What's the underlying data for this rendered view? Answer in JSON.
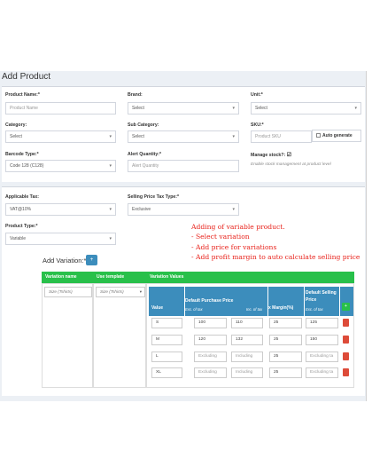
{
  "page": {
    "title": "Add Product"
  },
  "form": {
    "product_name": {
      "label": "Product Name:*",
      "placeholder": "Product Name"
    },
    "brand": {
      "label": "Brand:",
      "value": "Select"
    },
    "unit": {
      "label": "Unit:*",
      "value": "Select"
    },
    "category": {
      "label": "Category:",
      "value": "Select"
    },
    "sub_category": {
      "label": "Sub Category:",
      "value": "Select"
    },
    "sku": {
      "label": "SKU:*",
      "placeholder": "Product SKU",
      "auto_generate": "Auto generate"
    },
    "barcode_type": {
      "label": "Barcode Type:*",
      "value": "Code 128 (C128)"
    },
    "alert_quantity": {
      "label": "Alert Quantity:*",
      "placeholder": "Alert Quantity"
    },
    "manage_stock": {
      "label": "Manage stock?:",
      "checked": true,
      "help": "Enable stock management at product level"
    },
    "applicable_tax": {
      "label": "Applicable Tax:",
      "value": "VAT@10%"
    },
    "selling_price_tax_type": {
      "label": "Selling Price Tax Type:*",
      "value": "Exclusive"
    },
    "product_type": {
      "label": "Product Type:*",
      "value": "Variable"
    }
  },
  "annotation": "Adding of variable product.\n- Select variation\n- Add price for variations\n- Add profit margin to auto calculate selling price",
  "variations": {
    "add_label": "Add Variation:*",
    "add_button": "+",
    "headers": {
      "name": "Variation name",
      "template": "Use template",
      "values": "Variation Values"
    },
    "name_placeholder": "Size (Tshirts)",
    "template_value": "Size (Tshirts)",
    "table": {
      "value": "Value",
      "purchase": "Default Purchase Price",
      "exc_tax": "Exc. of tax",
      "inc_tax": "Inc. of tax",
      "margin": "x Margin(%)",
      "selling": "Default Selling Price",
      "selling_exc": "Exc. of tax",
      "add_row": "+"
    },
    "rows": [
      {
        "value": "S",
        "exc": "100",
        "inc": "110",
        "margin": "25",
        "sell": "125",
        "sell_ph": false
      },
      {
        "value": "M",
        "exc": "120",
        "inc": "132",
        "margin": "25",
        "sell": "150",
        "sell_ph": false
      },
      {
        "value": "L",
        "exc": "Excluding",
        "inc": "Including",
        "margin": "25",
        "sell": "Excluding ta",
        "sell_ph": true
      },
      {
        "value": "XL",
        "exc": "Excluding",
        "inc": "Including",
        "margin": "25",
        "sell": "Excluding ta",
        "sell_ph": true
      }
    ]
  },
  "colors": {
    "primary": "#3c8dbc",
    "success": "#28c04a",
    "danger": "#dd4b39",
    "annotation": "#e8231c"
  }
}
